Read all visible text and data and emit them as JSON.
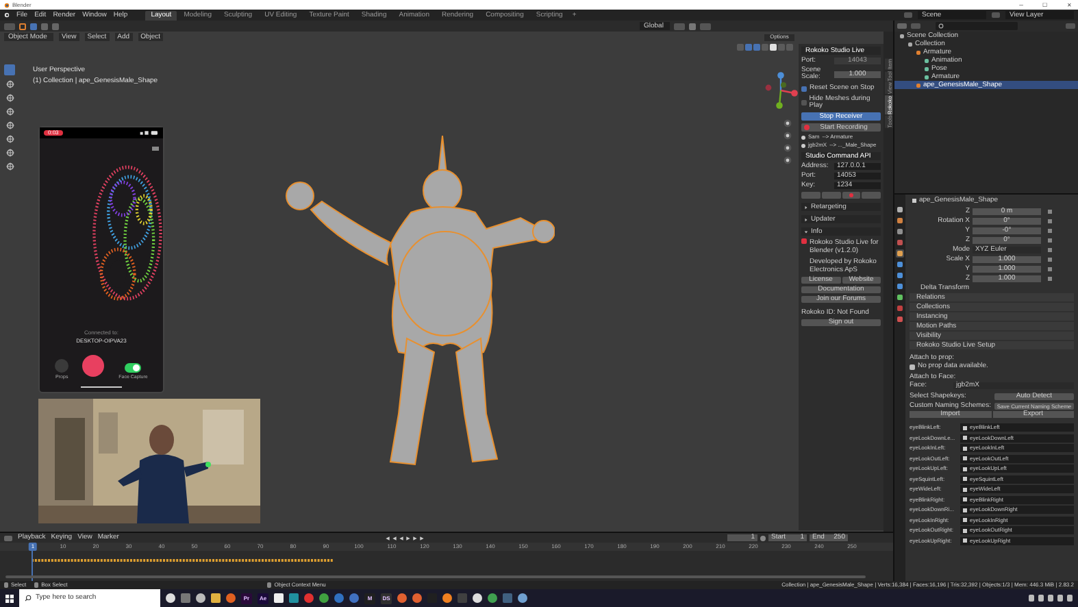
{
  "window": {
    "title": "Blender",
    "controls": [
      "─",
      "☐",
      "✕"
    ]
  },
  "menu": [
    "File",
    "Edit",
    "Render",
    "Window",
    "Help"
  ],
  "workspaces": [
    {
      "label": "Layout",
      "selected": true
    },
    {
      "label": "Modeling",
      "selected": false
    },
    {
      "label": "Sculpting",
      "selected": false
    },
    {
      "label": "UV Editing",
      "selected": false
    },
    {
      "label": "Texture Paint",
      "selected": false
    },
    {
      "label": "Shading",
      "selected": false
    },
    {
      "label": "Animation",
      "selected": false
    },
    {
      "label": "Rendering",
      "selected": false
    },
    {
      "label": "Compositing",
      "selected": false
    },
    {
      "label": "Scripting",
      "selected": false
    }
  ],
  "add_workspace": "+",
  "scene": "Scene",
  "view_layer": "View Layer",
  "viewport": {
    "transform": "Global",
    "options": "Options",
    "mode": "Object Mode",
    "menus": [
      "View",
      "Select",
      "Add",
      "Object"
    ],
    "title": "User Perspective",
    "subtitle": "(1) Collection | ape_GenesisMale_Shape"
  },
  "phone": {
    "timer": "0:03",
    "connected_label": "Connected to:",
    "device": "DESKTOP-OIPVA23",
    "controls": [
      {
        "kind": "button",
        "label": "Props"
      },
      {
        "kind": "toggle",
        "label": "Face Capture",
        "on": true
      }
    ]
  },
  "studio_panel": {
    "title": "Rokoko Studio Live",
    "fields": [
      {
        "label": "Port:",
        "value": "14043",
        "disabled": true
      },
      {
        "label": "Scene Scale:",
        "value": "1.000",
        "disabled": false
      }
    ],
    "checks": [
      {
        "label": "Reset Scene on Stop",
        "checked": true
      },
      {
        "label": "Hide Meshes during Play",
        "checked": false
      }
    ],
    "stop_receiver": "Stop Receiver",
    "start_recording": "Start Recording",
    "assignments": [
      {
        "source": "Sam",
        "target": "--> Armature"
      },
      {
        "source": "jgb2mX",
        "target": "--> ..._Male_Shape"
      }
    ],
    "api_title": "Studio Command API",
    "api_fields": [
      {
        "label": "Address:",
        "value": "127.0.0.1"
      },
      {
        "label": "Port:",
        "value": "14053"
      },
      {
        "label": "Key:",
        "value": "1234"
      }
    ],
    "sections": [
      {
        "label": "Retargeting",
        "expanded": false
      },
      {
        "label": "Updater",
        "expanded": false
      },
      {
        "label": "Info",
        "expanded": true
      }
    ],
    "info": [
      "Rokoko Studio Live for Blender (v1.2.0)",
      "Developed by Rokoko Electronics ApS"
    ],
    "info_buttons": [
      [
        "License",
        "Website"
      ],
      [
        "Documentation"
      ],
      [
        "Join our Forums"
      ]
    ],
    "id_text": "Rokoko ID: Not Found",
    "sign_out": "Sign out"
  },
  "side_tabs": [
    {
      "label": "Item",
      "selected": false
    },
    {
      "label": "Tool",
      "selected": false
    },
    {
      "label": "View",
      "selected": false
    },
    {
      "label": "Rokoko",
      "selected": true
    },
    {
      "label": "Tools",
      "selected": false
    }
  ],
  "outliner": {
    "items": [
      {
        "label": "Scene Collection",
        "selected": false,
        "children": [
          {
            "label": "Collection",
            "selected": false,
            "children": [
              {
                "label": "Armature",
                "selected": false,
                "children": [
                  {
                    "label": "Animation",
                    "selected": false
                  },
                  {
                    "label": "Pose",
                    "selected": false
                  },
                  {
                    "label": "Armature",
                    "selected": false
                  }
                ]
              },
              {
                "label": "ape_GenesisMale_Shape",
                "selected": true
              }
            ]
          }
        ]
      }
    ]
  },
  "properties": {
    "object": "ape_GenesisMale_Shape",
    "transform": [
      {
        "label": "Z",
        "value": "0 m"
      },
      {
        "label": "Rotation X",
        "value": "0°"
      },
      {
        "label": "Y",
        "value": "-0°"
      },
      {
        "label": "Z",
        "value": "0°"
      },
      {
        "label": "Mode",
        "value": "XYZ Euler",
        "kind": "dropdown"
      },
      {
        "label": "Scale X",
        "value": "1.000"
      },
      {
        "label": "Y",
        "value": "1.000"
      },
      {
        "label": "Z",
        "value": "1.000"
      }
    ],
    "delta": "Delta Transform",
    "sections": [
      "Relations",
      "Collections",
      "Instancing",
      "Motion Paths",
      "Visibility",
      "Rokoko Studio Live Setup"
    ],
    "attach_prop": "Attach to prop:",
    "no_prop": "No prop data available.",
    "attach_face": "Attach to Face:",
    "face_label": "Face:",
    "face_value": "jgb2mX",
    "shapekeys_label": "Select Shapekeys:",
    "auto_detect": "Auto Detect",
    "naming_label": "Custom Naming Schemes:",
    "save_naming": "Save Current Naming Scheme",
    "import": "Import",
    "export": "Export",
    "shapekeys": [
      {
        "label": "eyeBlinkLeft:",
        "value": "eyeBlinkLeft"
      },
      {
        "label": "eyeLookDownLe...",
        "value": "eyeLookDownLeft"
      },
      {
        "label": "eyeLookInLeft:",
        "value": "eyeLookInLeft"
      },
      {
        "label": "eyeLookOutLeft:",
        "value": "eyeLookOutLeft"
      },
      {
        "label": "eyeLookUpLeft:",
        "value": "eyeLookUpLeft"
      },
      {
        "label": "eyeSquintLeft:",
        "value": "eyeSquintLeft"
      },
      {
        "label": "eyeWideLeft:",
        "value": "eyeWideLeft"
      },
      {
        "label": "eyeBlinkRight:",
        "value": "eyeBlinkRight"
      },
      {
        "label": "eyeLookDownRi...",
        "value": "eyeLookDownRight"
      },
      {
        "label": "eyeLookInRight:",
        "value": "eyeLookInRight"
      },
      {
        "label": "eyeLookOutRight:",
        "value": "eyeLookOutRight"
      },
      {
        "label": "eyeLookUpRight:",
        "value": "eyeLookUpRight"
      }
    ],
    "tabs": [
      {
        "color": "#b0b0b0",
        "selected": false
      },
      {
        "color": "#d08040",
        "selected": false
      },
      {
        "color": "#8f8f8f",
        "selected": false
      },
      {
        "color": "#c05050",
        "selected": false
      },
      {
        "color": "#e0a050",
        "selected": true
      },
      {
        "color": "#4d8fd8",
        "selected": false
      },
      {
        "color": "#4d8fd8",
        "selected": false
      },
      {
        "color": "#4d8fd8",
        "selected": false
      },
      {
        "color": "#60c060",
        "selected": false
      },
      {
        "color": "#c04040",
        "selected": false
      },
      {
        "color": "#d05050",
        "selected": false
      }
    ]
  },
  "timeline": {
    "menus": [
      "Playback",
      "Keying",
      "View",
      "Marker"
    ],
    "current": "1",
    "start_label": "Start",
    "start": "1",
    "end_label": "End",
    "end": "250",
    "ruler": [
      "10",
      "20",
      "30",
      "40",
      "50",
      "60",
      "70",
      "80",
      "90",
      "100",
      "110",
      "120",
      "130",
      "140",
      "150",
      "160",
      "170",
      "180",
      "190",
      "200",
      "210",
      "220",
      "230",
      "240",
      "250"
    ],
    "marker": "1"
  },
  "status": {
    "hints": [
      "Select",
      "Box Select",
      "Object Context Menu"
    ],
    "stats": "Collection | ape_GenesisMale_Shape | Verts:16,384 | Faces:16,196 | Tris:32,392 | Objects:1/3 | Mem: 446.3 MiB | 2.83.2"
  },
  "taskbar": {
    "search": "Type here to search",
    "apps": [
      {
        "kind": "circle",
        "color": "#dddddd"
      },
      {
        "kind": "square",
        "color": "#777777"
      },
      {
        "kind": "circle",
        "color": "#bbbbbb"
      },
      {
        "kind": "square",
        "color": "#e0b040"
      },
      {
        "kind": "circle",
        "color": "#e06020"
      },
      {
        "kind": "letter",
        "label": "Pr",
        "color": "#2a0a3a"
      },
      {
        "kind": "letter",
        "label": "Ae",
        "color": "#1a0a3a"
      },
      {
        "kind": "square",
        "color": "#eeeeee"
      },
      {
        "kind": "square",
        "color": "#2090a0"
      },
      {
        "kind": "circle",
        "color": "#e03030"
      },
      {
        "kind": "circle",
        "color": "#40a040"
      },
      {
        "kind": "circle",
        "color": "#3070c0"
      },
      {
        "kind": "circle",
        "color": "#4070c0"
      },
      {
        "kind": "letter",
        "label": "M",
        "color": "#202020"
      },
      {
        "kind": "letter",
        "label": "DS",
        "color": "#303030"
      },
      {
        "kind": "circle",
        "color": "#e06030"
      },
      {
        "kind": "circle",
        "color": "#e06030"
      },
      {
        "kind": "square",
        "color": "#202020"
      },
      {
        "kind": "circle",
        "color": "#f08020"
      },
      {
        "kind": "square",
        "color": "#404040"
      },
      {
        "kind": "circle",
        "color": "#dddddd"
      },
      {
        "kind": "circle",
        "color": "#40a050"
      },
      {
        "kind": "square",
        "color": "#406080"
      },
      {
        "kind": "circle",
        "color": "#70a0d0"
      }
    ]
  }
}
